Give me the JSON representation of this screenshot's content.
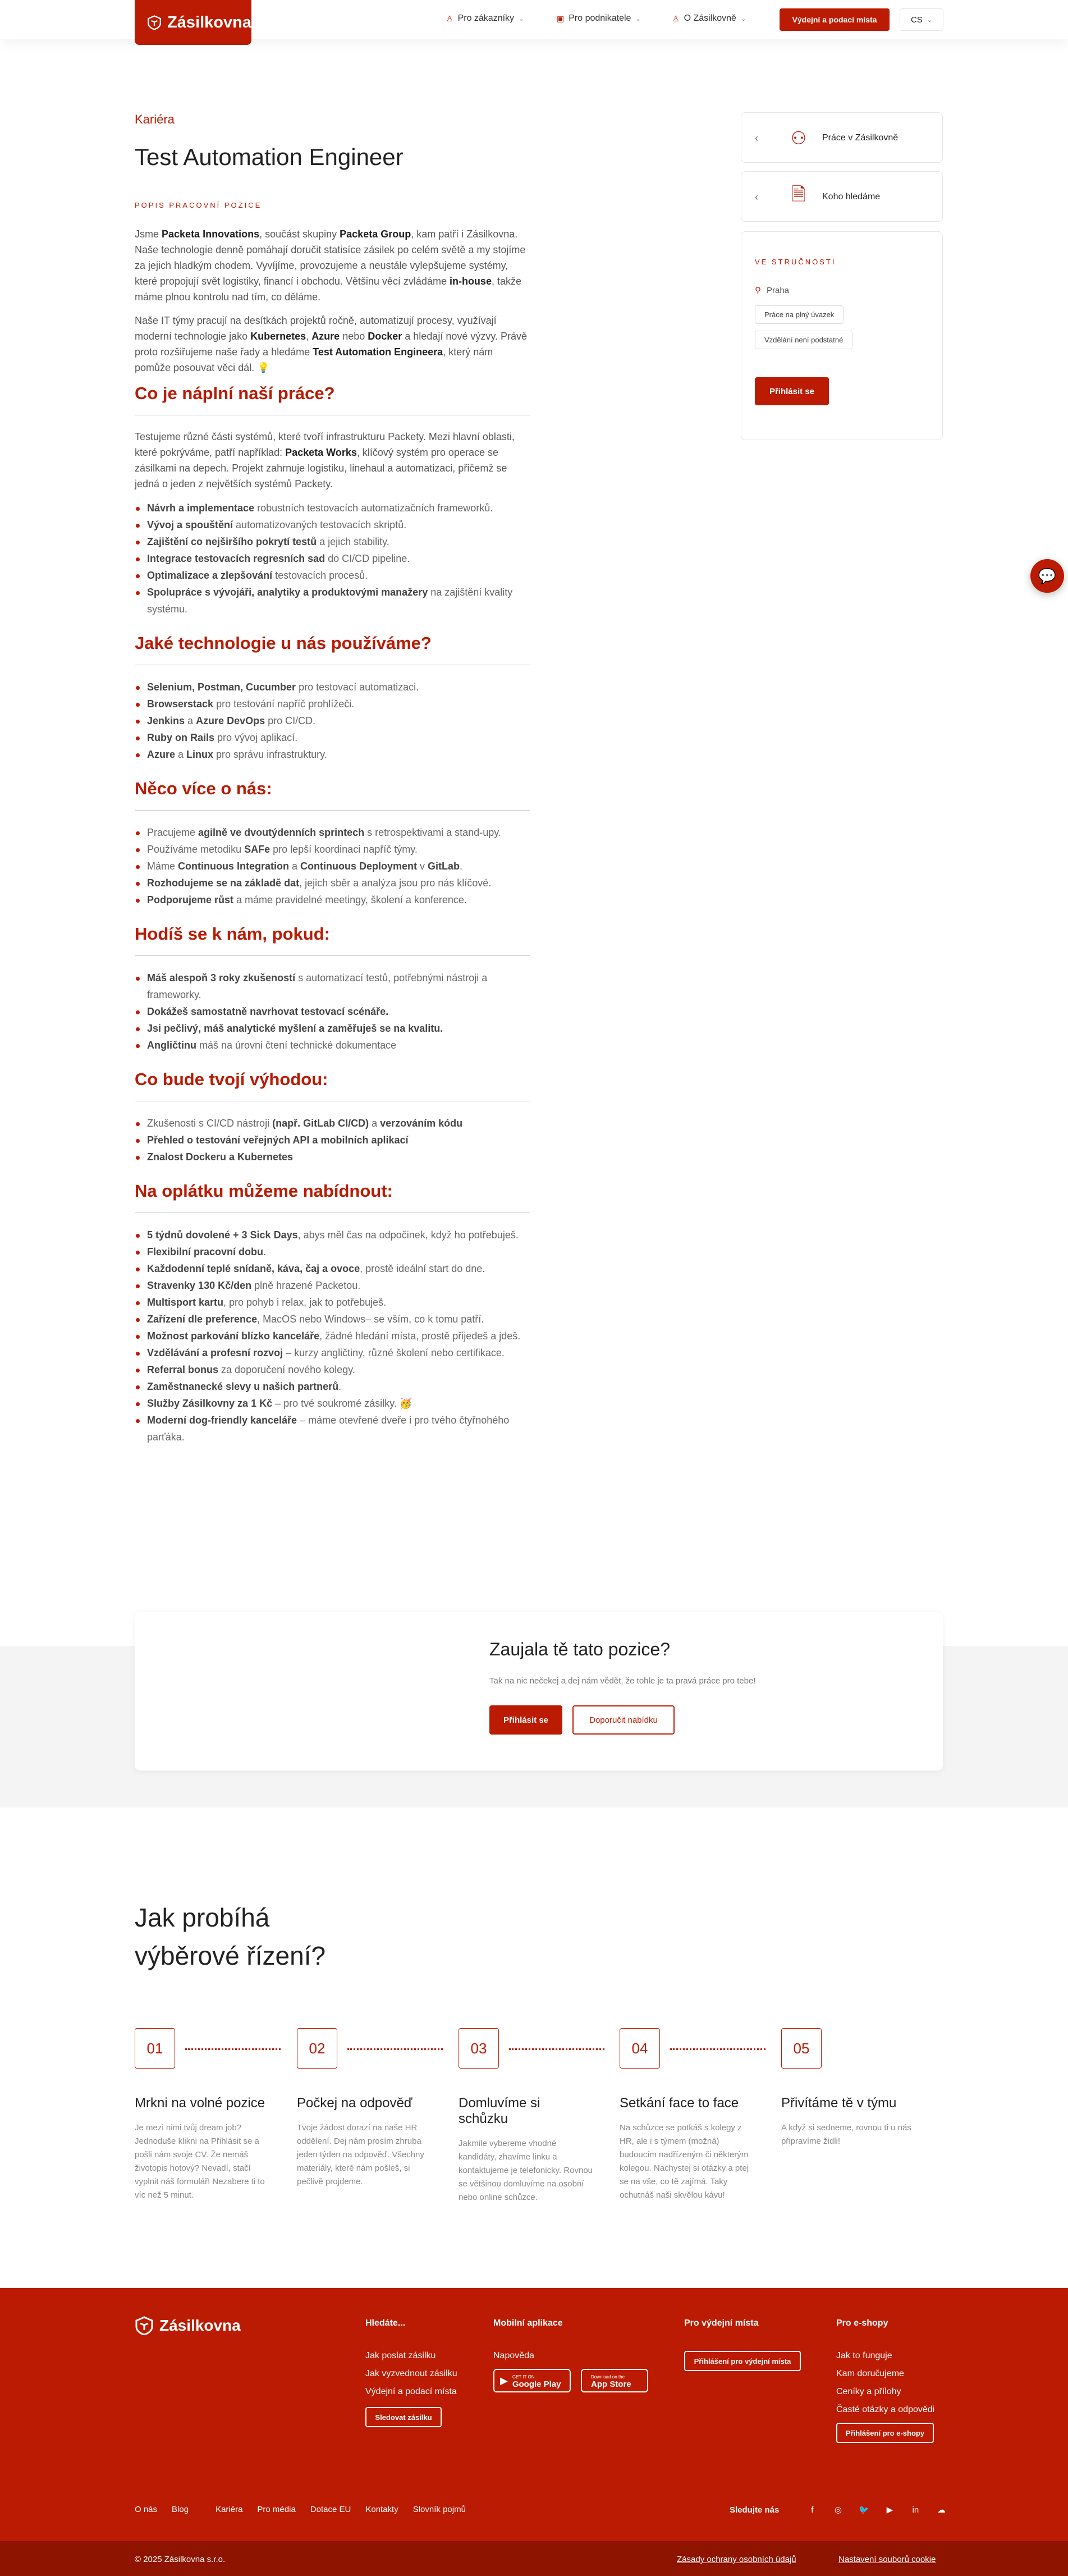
{
  "header": {
    "logo_text": "Zásilkovna",
    "nav": [
      {
        "label": "Pro zákazníky"
      },
      {
        "label": "Pro podnikatele"
      },
      {
        "label": "O Zásilkovně"
      }
    ],
    "cta_label": "Výdejní a podací místa",
    "lang_label": "CS"
  },
  "main": {
    "breadcrumb": "Kariéra",
    "title": "Test Automation Engineer",
    "section_label": "POPIS PRACOVNÍ POZICE",
    "intro_1": {
      "a": "Jsme ",
      "b": "Packeta Innovations",
      "c": ", součást skupiny ",
      "d": "Packeta Group",
      "e": ", kam patří i Zásilkovna. Naše technologie denně pomáhají doručit statisíce zásilek po celém světě a my stojíme za jejich hladkým chodem. Vyvíjíme, provozujeme a neustále vylepšujeme systémy, které propojují svět logistiky, financí i obchodu. Většinu věcí zvládáme ",
      "f": "in-house",
      "g": ", takže máme plnou kontrolu nad tím, co děláme."
    },
    "intro_2": {
      "a": "Naše IT týmy pracují na desítkách projektů ročně, automatizují procesy, využívají moderní technologie jako ",
      "b": "Kubernetes",
      "c": ", ",
      "d": "Azure",
      "e": " nebo ",
      "f": "Docker",
      "g": " a hledají nové výzvy. Právě proto rozšiřujeme naše řady a hledáme ",
      "h": "Test Automation Engineera",
      "i": ", který nám pomůže posouvat věci dál. 💡"
    },
    "s1": {
      "title": "Co je náplní naší práce?",
      "text_a": "Testujeme různé části systémů, které tvoří infrastrukturu Packety. Mezi hlavní oblasti, které pokrýváme, patří například: ",
      "text_b": "Packeta Works",
      "text_c": ", klíčový systém pro operace se zásilkami na depech. Projekt zahrnuje logistiku, linehaul a automatizaci, přičemž se jedná o jeden z největších systémů Packety.",
      "items": [
        {
          "b": "Návrh a implementace",
          "t": " robustních testovacích automatizačních frameworků."
        },
        {
          "b": "Vývoj a spouštění",
          "t": " automatizovaných testovacích skriptů."
        },
        {
          "b": "Zajištění co nejširšího pokrytí testů",
          "t": " a jejich stability."
        },
        {
          "b": "Integrace testovacích regresních sad",
          "t": " do CI/CD pipeline."
        },
        {
          "b": "Optimalizace a zlepšování",
          "t": " testovacích procesů."
        },
        {
          "b": "Spolupráce s vývojáři, analytiky a produktovými manažery",
          "t": " na zajištění kvality systému."
        }
      ]
    },
    "s2": {
      "title": "Jaké technologie u nás používáme?",
      "items": [
        {
          "b": "Selenium, Postman, Cucumber",
          "t": " pro testovací automatizaci."
        },
        {
          "b": "Browserstack",
          "t": " pro testování napříč prohlížeči."
        },
        {
          "b": "Jenkins",
          "t": " a ",
          "b2": "Azure DevOps",
          "t2": " pro CI/CD."
        },
        {
          "b": "Ruby on Rails",
          "t": " pro vývoj aplikací."
        },
        {
          "b": "Azure",
          "t": " a ",
          "b2": "Linux",
          "t2": " pro správu infrastruktury."
        }
      ]
    },
    "s3": {
      "title": "Něco více o nás:",
      "items": [
        {
          "t0": "Pracujeme ",
          "b": "agilně ve dvoutýdenních sprintech",
          "t": " s retrospektivami a stand-upy."
        },
        {
          "t0": "Používáme metodiku ",
          "b": "SAFe",
          "t": " pro lepší koordinaci napříč týmy."
        },
        {
          "t0": "Máme ",
          "b": "Continuous Integration",
          "t": " a ",
          "b2": "Continuous Deployment",
          "t2": " v ",
          "b3": "GitLab",
          "t3": "."
        },
        {
          "t0": "",
          "b": "Rozhodujeme se na základě dat",
          "t": ", jejich sběr a analýza jsou pro nás klíčové."
        },
        {
          "t0": "",
          "b": "Podporujeme růst",
          "t": " a máme pravidelné meetingy, školení a konference."
        }
      ]
    },
    "s4": {
      "title": "Hodíš se k nám, pokud:",
      "items": [
        {
          "b": "Máš alespoň 3 roky zkušeností",
          "t": " s automatizací testů, potřebnými nástroji a frameworky."
        },
        {
          "b": "Dokážeš samostatně navrhovat testovací scénáře.",
          "t": ""
        },
        {
          "b": "Jsi pečlivý, máš analytické myšlení a zaměřuješ se na kvalitu.",
          "t": ""
        },
        {
          "b": "Angličtinu",
          "t": " máš na úrovni čtení technické dokumentace"
        }
      ]
    },
    "s5": {
      "title": "Co bude tvojí výhodou:",
      "items": [
        {
          "t0": "Zkušenosti s CI/CD nástroji ",
          "b": "(např. GitLab CI/CD)",
          "t": " a ",
          "b2": "verzováním kódu"
        },
        {
          "t0": "",
          "b": "Přehled o testování veřejných API a mobilních aplikací",
          "t": ""
        },
        {
          "t0": "",
          "b": "Znalost Dockeru a Kubernetes",
          "t": ""
        }
      ]
    },
    "s6": {
      "title": "Na oplátku můžeme nabídnout:",
      "items": [
        {
          "b": "5 týdnů dovolené + 3 Sick Days",
          "t": ", abys měl čas na odpočinek, když ho potřebuješ."
        },
        {
          "b": "Flexibilní pracovní dobu",
          "t": "."
        },
        {
          "b": "Každodenní teplé snídaně, káva, čaj a ovoce",
          "t": ", prostě ideální start do dne."
        },
        {
          "b": "Stravenky 130 Kč/den",
          "t": " plně hrazené Packetou."
        },
        {
          "b": "Multisport kartu",
          "t": ", pro pohyb i relax, jak to potřebuješ."
        },
        {
          "b": "Zařízení dle preference",
          "t": ", MacOS nebo Windows– se vším, co k tomu patří."
        },
        {
          "b": "Možnost parkování blízko kanceláře",
          "t": ", žádné hledání místa, prostě přijedeš a jdeš."
        },
        {
          "b": "Vzdělávání a profesní rozvoj",
          "t": " – kurzy angličtiny, různé školení nebo certifikace."
        },
        {
          "b": "Referral bonus",
          "t": " za doporučení nového kolegy."
        },
        {
          "b": "Zaměstnanecké slevy u našich partnerů",
          "t": "."
        },
        {
          "b": "Služby Zásilkovny za 1 Kč",
          "t": " – pro tvé soukromé zásilky. 🥳"
        },
        {
          "b": "Moderní dog-friendly kanceláře",
          "t": " – máme otevřené dveře i pro tvého čtyřnohého parťáka."
        }
      ]
    }
  },
  "sidebar": {
    "links": [
      {
        "label": "Práce v Zásilkovně"
      },
      {
        "label": "Koho hledáme"
      }
    ],
    "summary_label": "VE STRUČNOSTI",
    "location": "Praha",
    "tags": [
      "Práce na plný úvazek",
      "Vzdělání není podstatné"
    ],
    "apply_label": "Přihlásit se"
  },
  "cta": {
    "title": "Zaujala tě tato pozice?",
    "text": "Tak na nic nečekej a dej nám vědět, že tohle je ta pravá práce pro tebe!",
    "apply_label": "Přihlásit se",
    "recommend_label": "Doporučit nabídku"
  },
  "process": {
    "title_line1": "Jak probíhá",
    "title_line2": "výběrové řízení?",
    "steps": [
      {
        "num": "01",
        "title": "Mrkni na volné pozice",
        "text": "Je mezi nimi tvůj dream job? Jednoduše klikni na Přihlásit se a pošli nám svoje CV. Že nemáš životopis hotový? Nevadí, stačí vyplnit náš formulář! Nezabere ti to víc než 5 minut."
      },
      {
        "num": "02",
        "title": "Počkej na odpověď",
        "text": "Tvoje žádost dorazí na naše HR oddělení. Dej nám prosím zhruba jeden týden na odpověď. Všechny materiály, které nám pošleš, si pečlivě projdeme."
      },
      {
        "num": "03",
        "title": "Domluvíme si schůzku",
        "text": "Jakmile vybereme vhodné kandidáty, zhavíme linku a kontaktujeme je telefonicky. Rovnou se většinou domluvíme na osobní nebo online schůzce."
      },
      {
        "num": "04",
        "title": "Setkání face to face",
        "text": "Na schůzce se potkáš s kolegy z HR, ale i s týmem (možná) budoucím nadřízeným či některým kolegou. Nachystej si otázky a ptej se na vše, co tě zajímá. Taky ochutnáš naši skvělou kávu!"
      },
      {
        "num": "05",
        "title": "Přivítáme tě v týmu",
        "text": "A když si sedneme, rovnou ti u nás připravíme židli!"
      }
    ]
  },
  "footer": {
    "logo_text": "Zásilkovna",
    "col1": {
      "title": "Hledáte...",
      "links": [
        "Jak poslat zásilku",
        "Jak vyzvednout zásilku",
        "Výdejní a podací místa"
      ],
      "button": "Sledovat zásilku"
    },
    "col2": {
      "title": "Mobilní aplikace",
      "link": "Napověda",
      "gp_small": "GET IT ON",
      "gp_big": "Google Play",
      "as_small": "Download on the",
      "as_big": "App Store"
    },
    "col3": {
      "title": "Pro výdejní místa",
      "button": "Přihlášení pro výdejní místa"
    },
    "col4": {
      "title": "Pro e-shopy",
      "links": [
        "Jak to funguje",
        "Kam doručujeme",
        "Ceníky a přílohy",
        "Časté otázky a odpovědi"
      ],
      "button": "Přihlášení pro e-shopy"
    },
    "bottom_links": [
      "O nás",
      "Blog",
      "Kariéra",
      "Pro média",
      "Dotace EU",
      "Kontakty",
      "Slovník pojmů"
    ],
    "follow_label": "Sledujte nás",
    "social": [
      "f",
      "◎",
      "🐦",
      "▶",
      "in",
      "☁"
    ],
    "copyright": "© 2025 Zásilkovna s.r.o.",
    "privacy": "Zásady ochrany osobních údajů",
    "cookies": "Nastavení souborů cookie"
  },
  "colors": {
    "brand": "#ba1b02",
    "footer_bottom": "#8e1400"
  }
}
